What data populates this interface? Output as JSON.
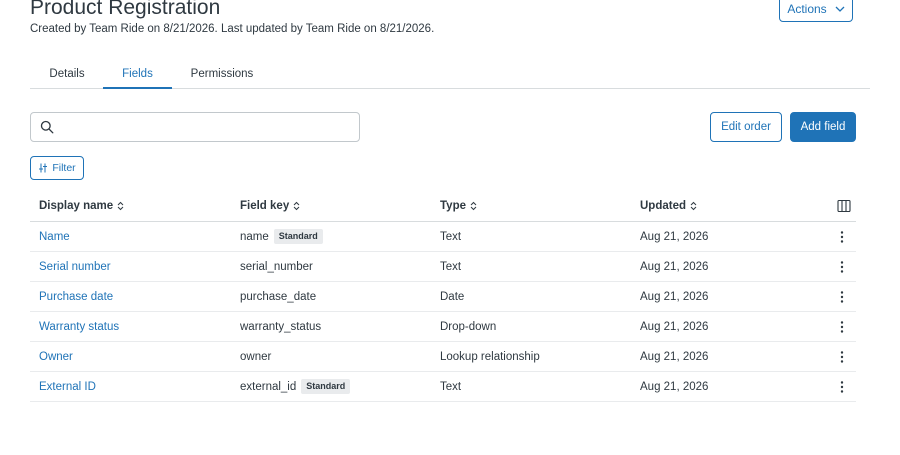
{
  "page": {
    "title": "Product Registration",
    "subtitle": "Created by Team Ride on 8/21/2026. Last updated by Team Ride on 8/21/2026."
  },
  "actions": {
    "label": "Actions",
    "icon": "chevron-down-icon"
  },
  "tabs": [
    {
      "label": "Details",
      "active": false
    },
    {
      "label": "Fields",
      "active": true
    },
    {
      "label": "Permissions",
      "active": false
    }
  ],
  "search": {
    "value": "",
    "placeholder": "",
    "icon": "search-icon"
  },
  "toolbar": {
    "edit_order_label": "Edit order",
    "add_field_label": "Add field"
  },
  "filter": {
    "label": "Filter",
    "icon": "sliders-icon"
  },
  "table": {
    "columns": [
      {
        "label": "Display name"
      },
      {
        "label": "Field key"
      },
      {
        "label": "Type"
      },
      {
        "label": "Updated"
      }
    ],
    "rows": [
      {
        "display_name": "Name",
        "field_key": "name",
        "badge": "Standard",
        "type": "Text",
        "updated": "Aug 21, 2026"
      },
      {
        "display_name": "Serial number",
        "field_key": "serial_number",
        "badge": "",
        "type": "Text",
        "updated": "Aug 21, 2026"
      },
      {
        "display_name": "Purchase date",
        "field_key": "purchase_date",
        "badge": "",
        "type": "Date",
        "updated": "Aug 21, 2026"
      },
      {
        "display_name": "Warranty status",
        "field_key": "warranty_status",
        "badge": "",
        "type": "Drop-down",
        "updated": "Aug 21, 2026"
      },
      {
        "display_name": "Owner",
        "field_key": "owner",
        "badge": "",
        "type": "Lookup relationship",
        "updated": "Aug 21, 2026"
      },
      {
        "display_name": "External ID",
        "field_key": "external_id",
        "badge": "Standard",
        "type": "Text",
        "updated": "Aug 21, 2026"
      }
    ]
  },
  "colors": {
    "accent": "#1f73b7",
    "text": "#2f3941",
    "border": "#d8dcde",
    "badge_bg": "#e9ebed"
  }
}
